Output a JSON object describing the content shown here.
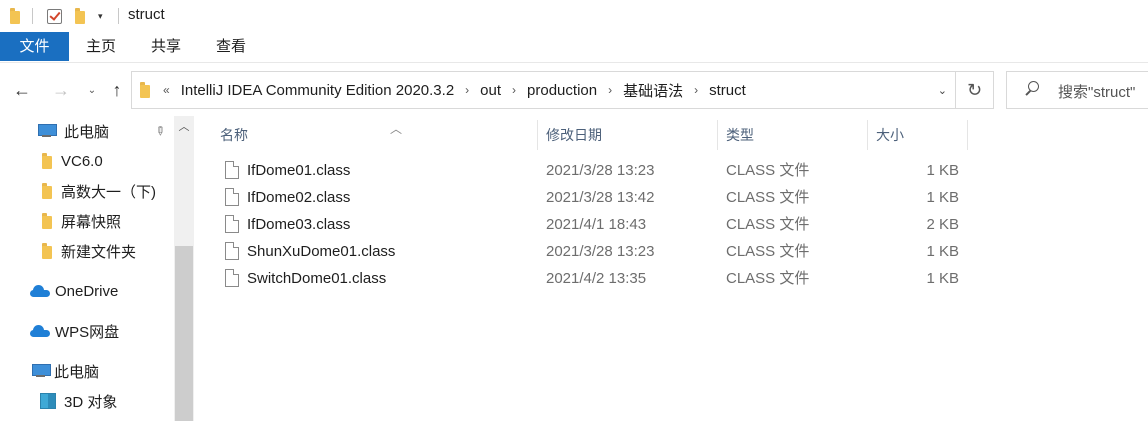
{
  "window": {
    "title": "struct"
  },
  "ribbon": {
    "tabs": [
      "文件",
      "主页",
      "共享",
      "查看"
    ]
  },
  "address": {
    "crumbs": [
      "IntelliJ IDEA Community Edition 2020.3.2",
      "out",
      "production",
      "基础语法",
      "struct"
    ],
    "overflow": "«"
  },
  "search": {
    "placeholder": "搜索\"struct\""
  },
  "nav": {
    "items": [
      {
        "label": "此电脑",
        "icon": "computer-icon"
      },
      {
        "label": "VC6.0",
        "icon": "folder-icon"
      },
      {
        "label": "高数大一（下)",
        "icon": "folder-icon"
      },
      {
        "label": "屏幕快照",
        "icon": "folder-icon"
      },
      {
        "label": "新建文件夹",
        "icon": "folder-icon"
      },
      {
        "label": "OneDrive",
        "icon": "cloud-icon"
      },
      {
        "label": "WPS网盘",
        "icon": "cloud-icon"
      },
      {
        "label": "此电脑",
        "icon": "computer-icon"
      },
      {
        "label": "3D 对象",
        "icon": "cube-icon"
      }
    ]
  },
  "columns": {
    "name": "名称",
    "modified": "修改日期",
    "type": "类型",
    "size": "大小"
  },
  "files": [
    {
      "name": "IfDome01.class",
      "modified": "2021/3/28 13:23",
      "type": "CLASS 文件",
      "size": "1 KB"
    },
    {
      "name": "IfDome02.class",
      "modified": "2021/3/28 13:42",
      "type": "CLASS 文件",
      "size": "1 KB"
    },
    {
      "name": "IfDome03.class",
      "modified": "2021/4/1 18:43",
      "type": "CLASS 文件",
      "size": "2 KB"
    },
    {
      "name": "ShunXuDome01.class",
      "modified": "2021/3/28 13:23",
      "type": "CLASS 文件",
      "size": "1 KB"
    },
    {
      "name": "SwitchDome01.class",
      "modified": "2021/4/2 13:35",
      "type": "CLASS 文件",
      "size": "1 KB"
    }
  ],
  "colors": {
    "accent": "#1a6fc1",
    "folder": "#f3c453",
    "header_text": "#4c607a"
  }
}
